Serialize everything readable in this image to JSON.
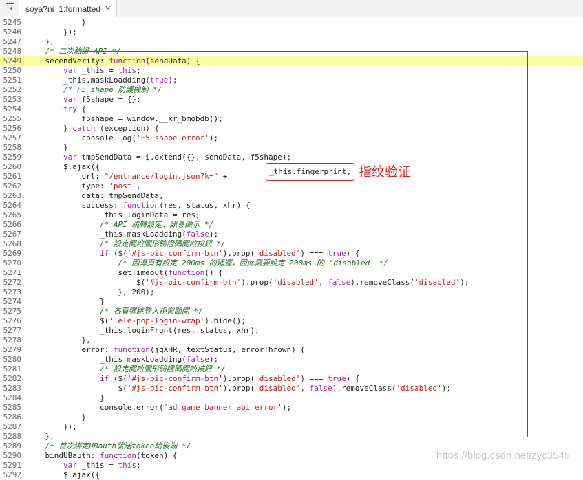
{
  "tab": {
    "title": "soya?ni=1:formatted",
    "close_glyph": "✕",
    "toggle_icon": "sidebar-toggle-icon"
  },
  "highlight_line": 5249,
  "annotations": {
    "fingerprint_text": "_this.fingerprint,",
    "label": "指纹验证",
    "color": "#e02020"
  },
  "watermark": "https://blog.csdn.net/zyc3545",
  "lines": [
    {
      "n": "5245",
      "t": "            }"
    },
    {
      "n": "5246",
      "t": "        });"
    },
    {
      "n": "5247",
      "t": "    },"
    },
    {
      "n": "5248",
      "t": "    /* 二次驗證 API */"
    },
    {
      "n": "5249",
      "t": "    secendVerify: function(sendData) {"
    },
    {
      "n": "5250",
      "t": "        var _this = this;"
    },
    {
      "n": "5251",
      "t": "        _this.maskLoadding(true);"
    },
    {
      "n": "5252",
      "t": "        /* F5 shape 防護機制 */"
    },
    {
      "n": "5253",
      "t": "        var f5shape = {};"
    },
    {
      "n": "5254",
      "t": "        try {"
    },
    {
      "n": "5255",
      "t": "            f5shape = window.__xr_bmobdb();"
    },
    {
      "n": "5256",
      "t": "        } catch (exception) {"
    },
    {
      "n": "5257",
      "t": "            console.log('F5 shape error');"
    },
    {
      "n": "5258",
      "t": "        }"
    },
    {
      "n": "5259",
      "t": "        var tmpSendData = $.extend({}, sendData, f5shape);"
    },
    {
      "n": "5260",
      "t": "        $.ajax({"
    },
    {
      "n": "5261",
      "t": "            url: \"/entrance/login.json?k=\" + "
    },
    {
      "n": "5262",
      "t": "            type: 'post',"
    },
    {
      "n": "5263",
      "t": "            data: tmpSendData,"
    },
    {
      "n": "5264",
      "t": "            success: function(res, status, xhr) {"
    },
    {
      "n": "5265",
      "t": "                _this.loginData = res;"
    },
    {
      "n": "5266",
      "t": "                /* API 跳轉設定、訊息顯示 */"
    },
    {
      "n": "5267",
      "t": "                _this.maskLoadding(false);"
    },
    {
      "n": "5268",
      "t": "                /* 設定開啟圖形驗證碼開啟按鈕 */"
    },
    {
      "n": "5269",
      "t": "                if ($('#js-pic-confirm-btn').prop('disabled') === true) {"
    },
    {
      "n": "5270",
      "t": "                    /* 因導頁有設定 200ms 的延遲，因此需要設定 200ms 的 'disabled' */"
    },
    {
      "n": "5271",
      "t": "                    setTimeout(function() {"
    },
    {
      "n": "5272",
      "t": "                        $('#js-pic-confirm-btn').prop('disabled', false).removeClass('disabled');"
    },
    {
      "n": "5273",
      "t": "                    }, 200);"
    },
    {
      "n": "5274",
      "t": "                }"
    },
    {
      "n": "5275",
      "t": "                /* 各頁彈跳登入視窗關閉 */"
    },
    {
      "n": "5276",
      "t": "                $('.ele-pop-login-wrap').hide();"
    },
    {
      "n": "5277",
      "t": "                _this.loginFront(res, status, xhr);"
    },
    {
      "n": "5278",
      "t": "            },"
    },
    {
      "n": "5279",
      "t": "            error: function(jqXHR, textStatus, errorThrown) {"
    },
    {
      "n": "5280",
      "t": "                _this.maskLoadding(false);"
    },
    {
      "n": "5281",
      "t": "                /* 設定開啟圖形驗證碼開啟按鈕 */"
    },
    {
      "n": "5282",
      "t": "                if ($('#js-pic-confirm-btn').prop('disabled') === true) {"
    },
    {
      "n": "5283",
      "t": "                    $('#js-pic-confirm-btn').prop('disabled', false).removeClass('disabled');"
    },
    {
      "n": "5284",
      "t": "                }"
    },
    {
      "n": "5285",
      "t": "                console.error('ad game banner api error');"
    },
    {
      "n": "5286",
      "t": "            }"
    },
    {
      "n": "5287",
      "t": "        });"
    },
    {
      "n": "5288",
      "t": "    },"
    },
    {
      "n": "5289",
      "t": "    /* 首次綁定UBauth發送token給後端 */"
    },
    {
      "n": "5290",
      "t": "    bindUBauth: function(token) {"
    },
    {
      "n": "5291",
      "t": "        var _this = this;"
    },
    {
      "n": "5292",
      "t": "        $.ajax({"
    }
  ]
}
